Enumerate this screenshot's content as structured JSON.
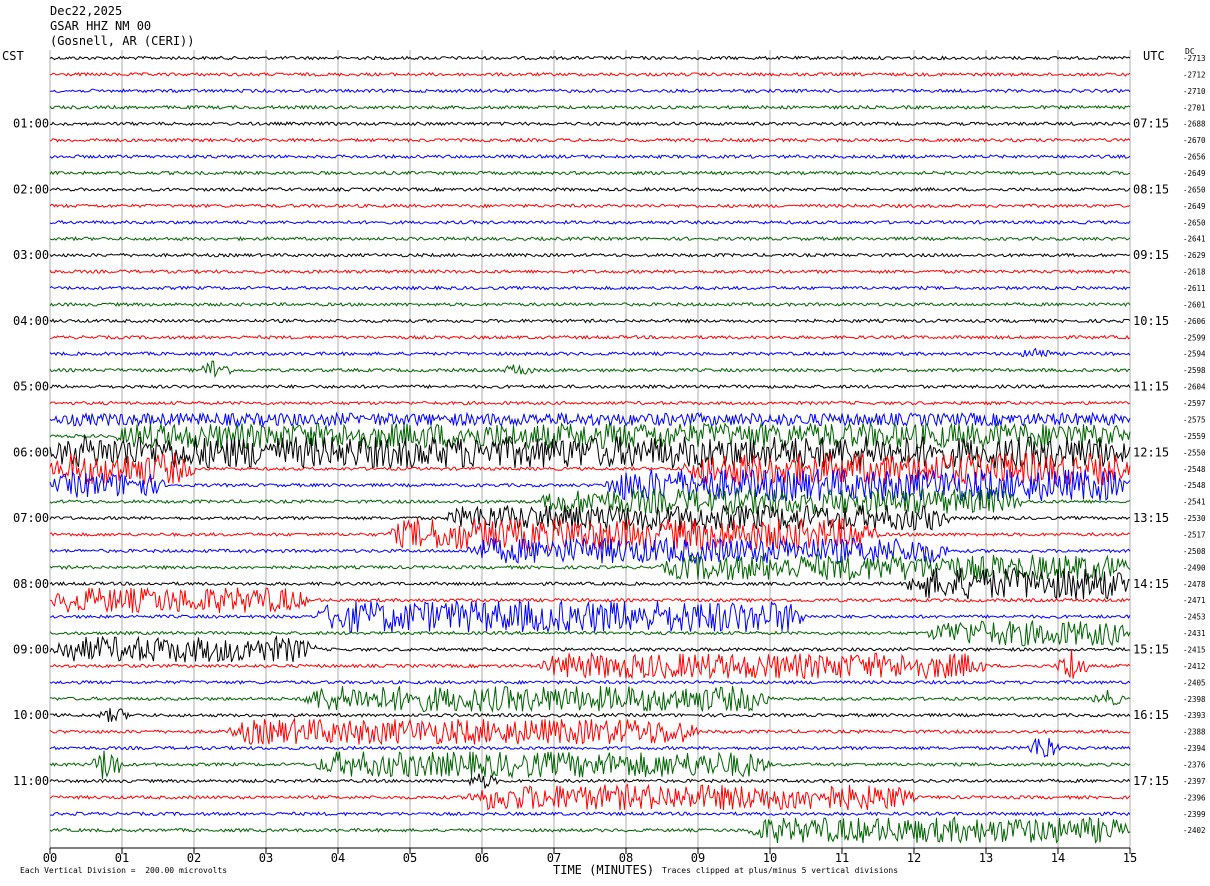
{
  "header": {
    "date": "Dec22,2025",
    "station": "GSAR HHZ NM 00",
    "location": "(Gosnell, AR (CERI))",
    "left_tz": "CST",
    "right_tz": "UTC",
    "dc_label": "DC"
  },
  "footer": {
    "division_note": "Each Vertical Division =  200.00 microvolts",
    "clip_note": "Traces clipped at plus/minus 5 vertical divisions"
  },
  "chart_data": {
    "type": "helicorder",
    "xlabel": "TIME (MINUTES)",
    "x_ticks": [
      "00",
      "01",
      "02",
      "03",
      "04",
      "05",
      "06",
      "07",
      "08",
      "09",
      "10",
      "11",
      "12",
      "13",
      "14",
      "15"
    ],
    "xlim": [
      0,
      15
    ],
    "grid": true,
    "trace_colors": [
      "#000000",
      "#ff0000",
      "#0000ff",
      "#006400"
    ],
    "left_hour_labels": [
      "01:00",
      "02:00",
      "03:00",
      "04:00",
      "05:00",
      "06:00",
      "07:00",
      "08:00",
      "09:00",
      "10:00",
      "11:00"
    ],
    "right_hour_labels": [
      "07:15",
      "08:15",
      "09:15",
      "10:15",
      "11:15",
      "12:15",
      "13:15",
      "14:15",
      "15:15",
      "16:15",
      "17:15"
    ],
    "dc_offsets": [
      -2713,
      -2712,
      -2710,
      -2701,
      -2688,
      -2670,
      -2656,
      -2649,
      -2650,
      -2649,
      -2650,
      -2641,
      -2629,
      -2618,
      -2611,
      -2601,
      -2606,
      -2599,
      -2594,
      -2598,
      -2604,
      -2597,
      -2575,
      -2559,
      -2550,
      -2548,
      -2548,
      -2541,
      -2530,
      -2517,
      -2508,
      -2490,
      -2478,
      -2471,
      -2453,
      -2431,
      -2415,
      -2412,
      -2405,
      -2398,
      -2393,
      -2388,
      -2394,
      -2376,
      -2397,
      -2396,
      -2399,
      -2402
    ],
    "noise_bursts": [
      {
        "line": 22,
        "start_min": 0.0,
        "end_min": 15,
        "amplitude": 2
      },
      {
        "line": 23,
        "start_min": 0.9,
        "end_min": 15,
        "amplitude": 4
      },
      {
        "line": 24,
        "start_min": 0,
        "end_min": 15,
        "amplitude": 5
      },
      {
        "line": 25,
        "start_min": 0,
        "end_min": 2.0,
        "amplitude": 5
      },
      {
        "line": 25,
        "start_min": 8.8,
        "end_min": 15,
        "amplitude": 5
      },
      {
        "line": 26,
        "start_min": 0,
        "end_min": 1.6,
        "amplitude": 4
      },
      {
        "line": 26,
        "start_min": 7.7,
        "end_min": 15,
        "amplitude": 5
      },
      {
        "line": 27,
        "start_min": 6.8,
        "end_min": 13.5,
        "amplitude": 4
      },
      {
        "line": 28,
        "start_min": 5.5,
        "end_min": 12.5,
        "amplitude": 4
      },
      {
        "line": 29,
        "start_min": 4.7,
        "end_min": 11.5,
        "amplitude": 5
      },
      {
        "line": 30,
        "start_min": 5.8,
        "end_min": 12.5,
        "amplitude": 4
      },
      {
        "line": 31,
        "start_min": 8.5,
        "end_min": 15,
        "amplitude": 4
      },
      {
        "line": 32,
        "start_min": 11.9,
        "end_min": 15,
        "amplitude": 5
      },
      {
        "line": 33,
        "start_min": 0,
        "end_min": 3.6,
        "amplitude": 4
      },
      {
        "line": 34,
        "start_min": 3.7,
        "end_min": 10.5,
        "amplitude": 5
      },
      {
        "line": 35,
        "start_min": 12.2,
        "end_min": 15,
        "amplitude": 4
      },
      {
        "line": 36,
        "start_min": 0,
        "end_min": 3.7,
        "amplitude": 4
      },
      {
        "line": 37,
        "start_min": 6.8,
        "end_min": 13.0,
        "amplitude": 4
      },
      {
        "line": 39,
        "start_min": 3.5,
        "end_min": 10.0,
        "amplitude": 4
      },
      {
        "line": 41,
        "start_min": 2.5,
        "end_min": 9.0,
        "amplitude": 4
      },
      {
        "line": 43,
        "start_min": 3.7,
        "end_min": 10.0,
        "amplitude": 4
      },
      {
        "line": 45,
        "start_min": 5.8,
        "end_min": 12.0,
        "amplitude": 4
      },
      {
        "line": 47,
        "start_min": 9.7,
        "end_min": 15,
        "amplitude": 4
      }
    ],
    "spikes": [
      {
        "line": 19,
        "at_min": 2.3,
        "amplitude": 3
      },
      {
        "line": 19,
        "at_min": 6.5,
        "amplitude": 1.5
      },
      {
        "line": 18,
        "at_min": 13.7,
        "amplitude": 1.5
      },
      {
        "line": 37,
        "at_min": 14.2,
        "amplitude": 5
      },
      {
        "line": 40,
        "at_min": 0.9,
        "amplitude": 2
      },
      {
        "line": 43,
        "at_min": 0.8,
        "amplitude": 5
      },
      {
        "line": 42,
        "at_min": 13.8,
        "amplitude": 4
      },
      {
        "line": 44,
        "at_min": 6.0,
        "amplitude": 2
      },
      {
        "line": 39,
        "at_min": 14.7,
        "amplitude": 2
      }
    ]
  }
}
